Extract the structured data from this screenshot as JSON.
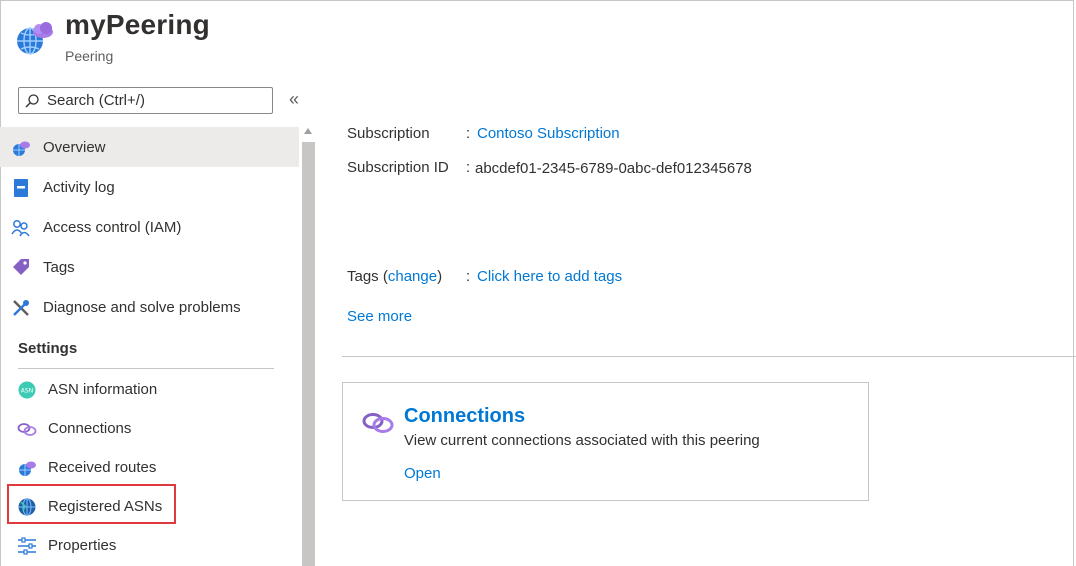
{
  "header": {
    "title": "myPeering",
    "subtitle": "Peering",
    "icon": "peering-globe-icon"
  },
  "search": {
    "placeholder": "Search (Ctrl+/)",
    "value": "",
    "collapse_glyph": "«"
  },
  "nav": {
    "items": [
      {
        "label": "Overview",
        "icon": "overview-cloud-icon",
        "selected": true
      },
      {
        "label": "Activity log",
        "icon": "activity-log-icon"
      },
      {
        "label": "Access control (IAM)",
        "icon": "iam-people-icon"
      },
      {
        "label": "Tags",
        "icon": "tag-icon"
      },
      {
        "label": "Diagnose and solve problems",
        "icon": "wrench-icon"
      }
    ],
    "settings_header": "Settings",
    "settings_items": [
      {
        "label": "ASN information",
        "icon": "asn-icon"
      },
      {
        "label": "Connections",
        "icon": "connections-link-icon"
      },
      {
        "label": "Received routes",
        "icon": "received-routes-icon"
      },
      {
        "label": "Registered ASNs",
        "icon": "registered-asns-globe-icon",
        "highlighted": true
      },
      {
        "label": "Properties",
        "icon": "properties-sliders-icon"
      }
    ]
  },
  "essentials": {
    "subscription_label": "Subscription",
    "subscription_value": "Contoso Subscription",
    "subscription_id_label": "Subscription ID",
    "subscription_id_value": "abcdef01-2345-6789-0abc-def012345678",
    "tags_label_prefix": "Tags (",
    "tags_change": "change",
    "tags_label_suffix": ")",
    "tags_value": "Click here to add tags",
    "see_more": "See more",
    "colon": ":"
  },
  "card": {
    "title": "Connections",
    "description": "View current connections associated with this peering",
    "link": "Open"
  },
  "colors": {
    "link": "#0078d4",
    "highlight": "#e0393e",
    "selected_bg": "#edebe9"
  }
}
